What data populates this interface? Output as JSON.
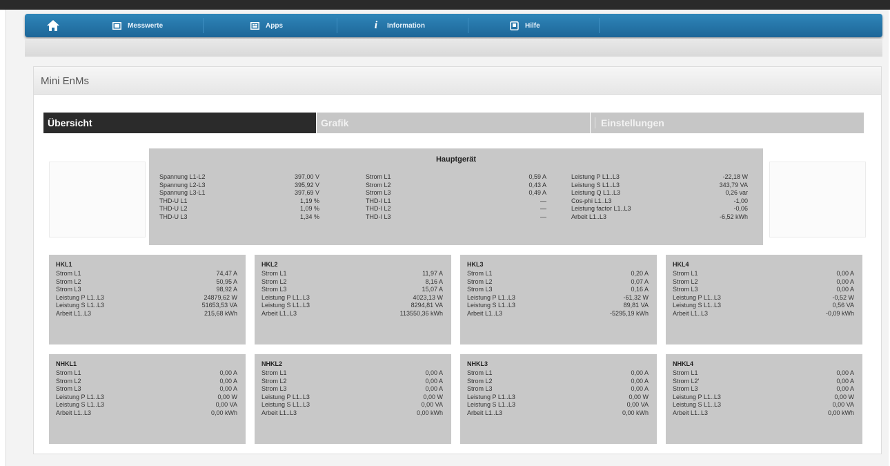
{
  "nav": {
    "items": [
      {
        "label": "Messwerte",
        "icon": "monitor-icon"
      },
      {
        "label": "Apps",
        "icon": "apps-icon"
      },
      {
        "label": "Information",
        "icon": "info-icon"
      },
      {
        "label": "Hilfe",
        "icon": "book-icon"
      }
    ]
  },
  "panel": {
    "title": "Mini EnMs"
  },
  "tabs": [
    {
      "label": "Übersicht",
      "active": true
    },
    {
      "label": "Grafik",
      "active": false
    },
    {
      "label": "Einstellungen",
      "active": false
    }
  ],
  "main_device": {
    "title": "Hauptgerät",
    "columns": [
      [
        {
          "label": "Spannung L1-L2",
          "value": "397,00 V"
        },
        {
          "label": "Spannung L2-L3",
          "value": "395,92 V"
        },
        {
          "label": "Spannung L3-L1",
          "value": "397,69 V"
        },
        {
          "label": "THD-U L1",
          "value": "1,19 %"
        },
        {
          "label": "THD-U L2",
          "value": "1,09 %"
        },
        {
          "label": "THD-U L3",
          "value": "1,34 %"
        }
      ],
      [
        {
          "label": "Strom L1",
          "value": "0,59 A"
        },
        {
          "label": "Strom L2",
          "value": "0,43 A"
        },
        {
          "label": "Strom L3",
          "value": "0,49 A"
        },
        {
          "label": "THD-I L1",
          "value": "—"
        },
        {
          "label": "THD-I L2",
          "value": "—"
        },
        {
          "label": "THD-I L3",
          "value": "—"
        }
      ],
      [
        {
          "label": "Leistung P L1..L3",
          "value": "-22,18 W"
        },
        {
          "label": "Leistung S L1..L3",
          "value": "343,79 VA"
        },
        {
          "label": "Leistung Q L1..L3",
          "value": "0,26 var"
        },
        {
          "label": "Cos-phi L1..L3",
          "value": "-1,00"
        },
        {
          "label": "Leistung factor L1..L3",
          "value": "-0,06"
        },
        {
          "label": "Arbeit L1..L3",
          "value": "-6,52 kWh"
        }
      ]
    ]
  },
  "subdevices": [
    {
      "title": "HKL1",
      "rows": [
        {
          "label": "Strom L1",
          "value": "74,47 A"
        },
        {
          "label": "Strom L2",
          "value": "50,95 A"
        },
        {
          "label": "Strom L3",
          "value": "98,92 A"
        },
        {
          "label": "Leistung P L1..L3",
          "value": "24879,62 W"
        },
        {
          "label": "Leistung S L1..L3",
          "value": "51653,53 VA"
        },
        {
          "label": "Arbeit L1..L3",
          "value": "215,68 kWh"
        }
      ]
    },
    {
      "title": "HKL2",
      "rows": [
        {
          "label": "Strom L1",
          "value": "11,97 A"
        },
        {
          "label": "Strom L2",
          "value": "8,16 A"
        },
        {
          "label": "Strom L3",
          "value": "15,07 A"
        },
        {
          "label": "Leistung P L1..L3",
          "value": "4023,13 W"
        },
        {
          "label": "Leistung S L1..L3",
          "value": "8294,81 VA"
        },
        {
          "label": "Arbeit L1..L3",
          "value": "113550,36 kWh"
        }
      ]
    },
    {
      "title": "HKL3",
      "rows": [
        {
          "label": "Strom L1",
          "value": "0,20 A"
        },
        {
          "label": "Strom L2",
          "value": "0,07 A"
        },
        {
          "label": "Strom L3",
          "value": "0,16 A"
        },
        {
          "label": "Leistung P L1..L3",
          "value": "-61,32 W"
        },
        {
          "label": "Leistung S L1..L3",
          "value": "89,81 VA"
        },
        {
          "label": "Arbeit L1..L3",
          "value": "-5295,19 kWh"
        }
      ]
    },
    {
      "title": "HKL4",
      "rows": [
        {
          "label": "Strom L1",
          "value": "0,00 A"
        },
        {
          "label": "Strom L2",
          "value": "0,00 A"
        },
        {
          "label": "Strom L3",
          "value": "0,00 A"
        },
        {
          "label": "Leistung P L1..L3",
          "value": "-0,52 W"
        },
        {
          "label": "Leistung S L1..L3",
          "value": "0,56 VA"
        },
        {
          "label": "Arbeit L1..L3",
          "value": "-0,09 kWh"
        }
      ]
    },
    {
      "title": "NHKL1",
      "rows": [
        {
          "label": "Strom L1",
          "value": "0,00 A"
        },
        {
          "label": "Strom L2",
          "value": "0,00 A"
        },
        {
          "label": "Strom L3",
          "value": "0,00 A"
        },
        {
          "label": "Leistung P L1..L3",
          "value": "0,00 W"
        },
        {
          "label": "Leistung S L1..L3",
          "value": "0,00 VA"
        },
        {
          "label": "Arbeit L1..L3",
          "value": "0,00 kWh"
        }
      ]
    },
    {
      "title": "NHKL2",
      "rows": [
        {
          "label": "Strom L1",
          "value": "0,00 A"
        },
        {
          "label": "Strom L2",
          "value": "0,00 A"
        },
        {
          "label": "Strom L3",
          "value": "0,00 A"
        },
        {
          "label": "Leistung P L1..L3",
          "value": "0,00 W"
        },
        {
          "label": "Leistung S L1..L3",
          "value": "0,00 VA"
        },
        {
          "label": "Arbeit L1..L3",
          "value": "0,00 kWh"
        }
      ]
    },
    {
      "title": "NHKL3",
      "rows": [
        {
          "label": "Strom L1",
          "value": "0,00 A"
        },
        {
          "label": "Strom L2",
          "value": "0,00 A"
        },
        {
          "label": "Strom L3",
          "value": "0,00 A"
        },
        {
          "label": "Leistung P L1..L3",
          "value": "0,00 W"
        },
        {
          "label": "Leistung S L1..L3",
          "value": "0,00 VA"
        },
        {
          "label": "Arbeit L1..L3",
          "value": "0,00 kWh"
        }
      ]
    },
    {
      "title": "NHKL4",
      "rows": [
        {
          "label": "Strom L1",
          "value": "0,00 A"
        },
        {
          "label": "Strom L2'",
          "value": "0,00 A"
        },
        {
          "label": "Strom L3",
          "value": "0,00 A"
        },
        {
          "label": "Leistung P L1..L3",
          "value": "0,00 W"
        },
        {
          "label": "Leistung S L1..L3",
          "value": "0,00 VA"
        },
        {
          "label": "Arbeit L1..L3",
          "value": "0,00 kWh"
        }
      ]
    }
  ]
}
